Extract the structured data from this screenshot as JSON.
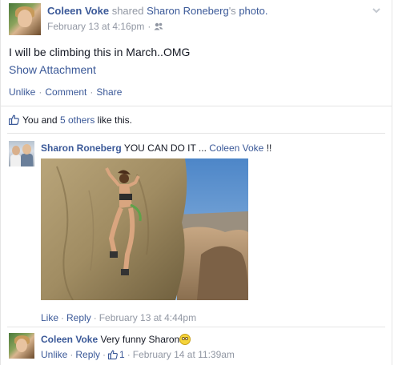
{
  "post": {
    "author": "Coleen Voke",
    "verb": "shared",
    "shared_owner": "Sharon Roneberg",
    "shared_suffix": "'s",
    "shared_object": "photo.",
    "timestamp": "February 13 at 4:16pm",
    "separator": "·",
    "audience_icon": "friends-icon",
    "text": "I will be climbing this in March..OMG",
    "show_attachment": "Show Attachment",
    "actions": [
      "Unlike",
      "Comment",
      "Share"
    ]
  },
  "likes": {
    "prefix": "You and",
    "others_link": "5 others",
    "suffix": "like this."
  },
  "comments": [
    {
      "author": "Sharon Roneberg",
      "text": "YOU CAN DO IT ...",
      "mention": "Coleen Voke",
      "trailing": "!!",
      "photo": "rock-climber-photo",
      "actions": [
        "Like",
        "Reply"
      ],
      "timestamp": "February 13 at 4:44pm"
    },
    {
      "author": "Coleen Voke",
      "text": "Very funny Sharon",
      "emoji": "flushed-face-emoji",
      "actions": [
        "Unlike",
        "Reply"
      ],
      "like_count": "1",
      "timestamp": "February 14 at 11:39am"
    }
  ],
  "colors": {
    "link": "#3b5998",
    "meta": "#9197a3",
    "text": "#141823",
    "divider": "#e5e5e5"
  }
}
